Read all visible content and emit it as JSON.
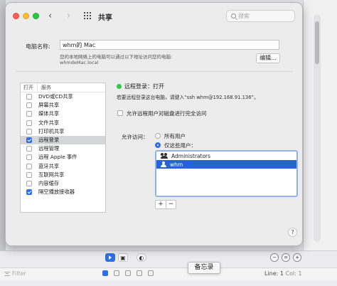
{
  "window": {
    "title": "共享",
    "search_placeholder": "搜索"
  },
  "computer_name": {
    "label": "电脑名称:",
    "value": "whm的 Mac",
    "description_line1": "您的本地网络上的电脑可以通过以下地址访问您的电脑:",
    "description_line2": "whmdeMac.local",
    "edit_label": "编辑..."
  },
  "services": {
    "header_on": "打开",
    "header_service": "服务",
    "items": [
      {
        "label": "DVD或CD共享",
        "checked": false
      },
      {
        "label": "屏幕共享",
        "checked": false
      },
      {
        "label": "媒体共享",
        "checked": false
      },
      {
        "label": "文件共享",
        "checked": false
      },
      {
        "label": "打印机共享",
        "checked": false
      },
      {
        "label": "远程登录",
        "checked": true
      },
      {
        "label": "远程管理",
        "checked": false
      },
      {
        "label": "远程 Apple 事件",
        "checked": false
      },
      {
        "label": "蓝牙共享",
        "checked": false
      },
      {
        "label": "互联网共享",
        "checked": false
      },
      {
        "label": "内容缓存",
        "checked": false
      },
      {
        "label": "隔空播放接收器",
        "checked": true
      }
    ],
    "selected_index": 5
  },
  "detail": {
    "status": "远程登录：打开",
    "status_color": "#2fc84a",
    "hint": "若要远程登录这台电脑，请键入“ssh whm@192.168.91.136”。",
    "full_disk_label": "允许远程用户对磁盘进行完全访问",
    "access_label": "允许访问：",
    "option_all": "所有用户",
    "option_only": "仅这些用户：",
    "selected_option": "only",
    "users": [
      {
        "name": "Administrators",
        "type": "group"
      },
      {
        "name": "whm",
        "type": "user"
      }
    ],
    "add_label": "+",
    "remove_label": "−",
    "help_label": "?"
  },
  "background": {
    "filter_placeholder": "Filter",
    "tooltip": "备忘录",
    "line_info": "Line: 1",
    "col_info": "Col: 1",
    "zoom_out": "−",
    "zoom_fit": "=",
    "zoom_in": "+"
  },
  "colors": {
    "accent": "#2f6fe6",
    "selection": "#2563d6"
  }
}
